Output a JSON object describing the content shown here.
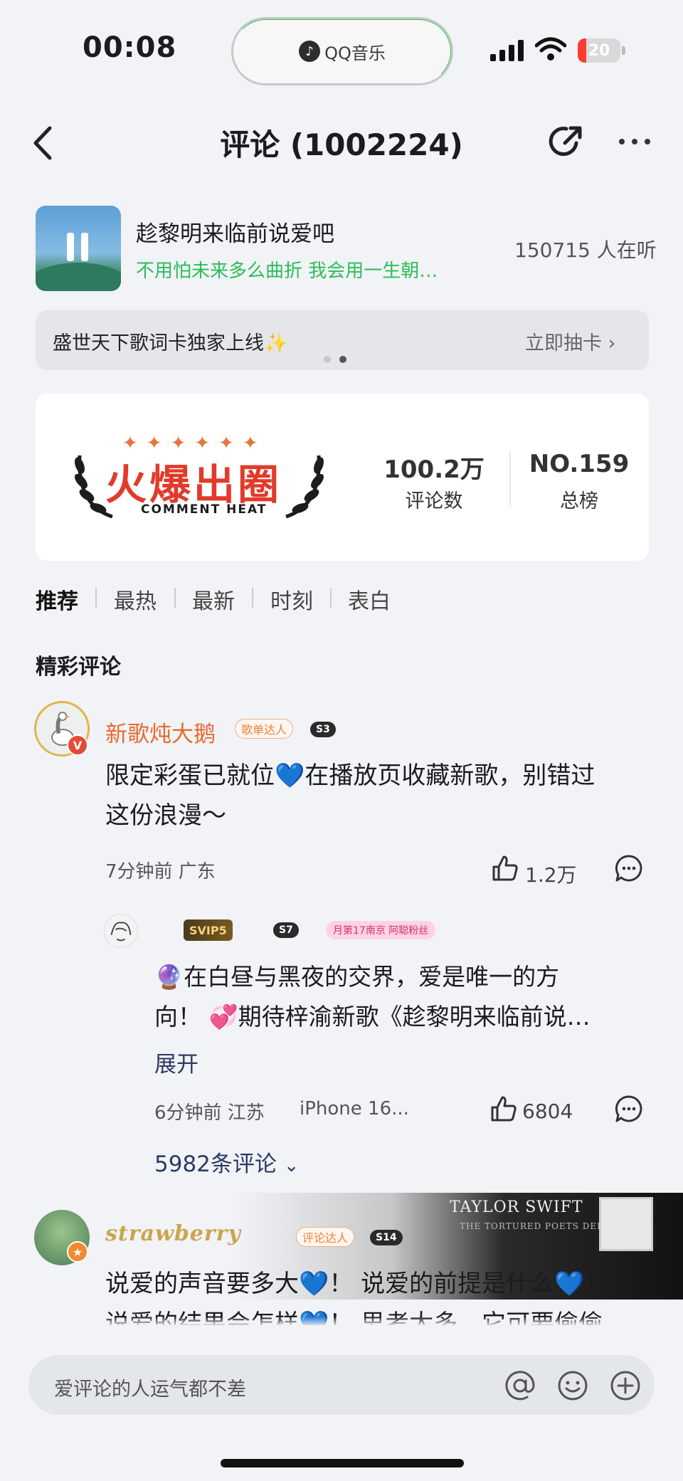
{
  "status_bar": {
    "time": "00:08",
    "dynamic_island_app": "QQ音乐",
    "battery": "20"
  },
  "nav": {
    "title": "评论 (1002224)"
  },
  "song": {
    "title": "趁黎明来临前说爱吧",
    "lyric": "不用怕未来多么曲折 我会用一生朝…",
    "listeners": "150715 人在听"
  },
  "banner": {
    "text": "盛世天下歌词卡独家上线✨",
    "action": "立即抽卡 ›"
  },
  "heat": {
    "logo": "火爆出圈",
    "logo_sub": "COMMENT HEAT",
    "stats": [
      {
        "value": "100.2万",
        "label": "评论数"
      },
      {
        "value": "NO.159",
        "label": "总榜"
      }
    ]
  },
  "tabs": [
    "推荐",
    "最热",
    "最新",
    "时刻",
    "表白"
  ],
  "section_title": "精彩评论",
  "comments": [
    {
      "username": "新歌炖大鹅",
      "tag": "歌单达人",
      "level": "S3",
      "avatar_badge": "V",
      "text_line1": "限定彩蛋已就位💙在播放页收藏新歌，别错过",
      "text_line2": "这份浪漫～",
      "meta": "7分钟前 广东",
      "likes": "1.2万",
      "reply": {
        "vip": "SVIP5",
        "level": "S7",
        "fan_tag": "月第17南京 阿聪粉丝",
        "text_line1": "🔮在白昼与黑夜的交界，爱是唯一的方",
        "text_line2": "向！ 💞期待梓渝新歌《趁黎明来临前说…",
        "expand": "展开",
        "meta": "6分钟前 江苏",
        "device": "iPhone 16...",
        "likes": "6804"
      },
      "reply_count": "5982条评论"
    },
    {
      "username": "strawberry",
      "tag": "评论达人",
      "level": "S14",
      "deco_title": "TAYLOR SWIFT",
      "deco_sub": "THE TORTURED POETS DEPARTMENT",
      "text_line1": "说爱的声音要多大💙！ 说爱的前提是什么💙！",
      "text_line2": "说爱的结果会怎样💙！ 思考太多，它可要偷偷"
    }
  ],
  "input": {
    "placeholder": "爱评论的人运气都不差"
  }
}
